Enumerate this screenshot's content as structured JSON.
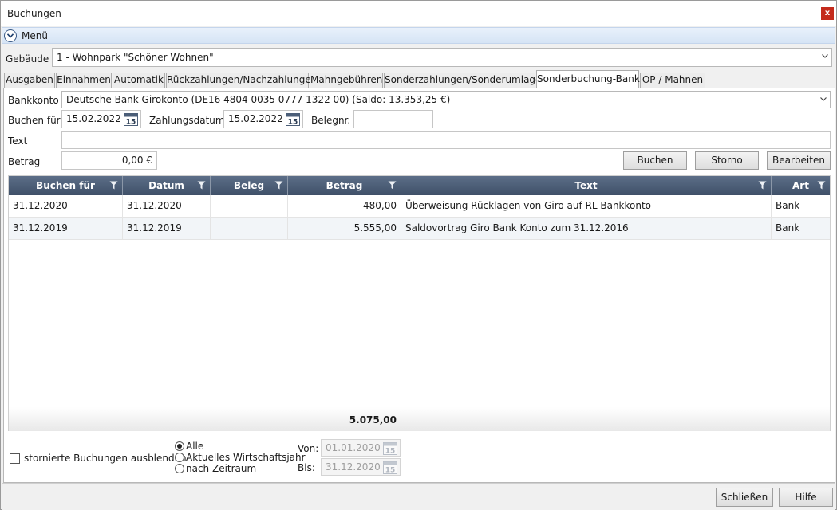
{
  "window": {
    "title": "Buchungen",
    "close_label": "x"
  },
  "menu": {
    "label": "Menü"
  },
  "building": {
    "label": "Gebäude",
    "value": "1 - Wohnpark \"Schöner Wohnen\""
  },
  "tabs": [
    {
      "label": "Ausgaben"
    },
    {
      "label": "Einnahmen"
    },
    {
      "label": "Automatik"
    },
    {
      "label": "Rückzahlungen/Nachzahlungen"
    },
    {
      "label": "Mahngebühren"
    },
    {
      "label": "Sonderzahlungen/Sonderumlagen"
    },
    {
      "label": "Sonderbuchung-Bank"
    },
    {
      "label": "OP / Mahnen"
    }
  ],
  "active_tab": "Sonderbuchung-Bank",
  "form": {
    "bankkonto_label": "Bankkonto",
    "bankkonto_value": "Deutsche Bank Girokonto (DE16 4804 0035 0777 1322 00) (Saldo: 13.353,25 €)",
    "buchen_fuer_label": "Buchen für",
    "buchen_fuer_value": "15.02.2022",
    "zahlungsdatum_label": "Zahlungsdatum",
    "zahlungsdatum_value": "15.02.2022",
    "belegnr_label": "Belegnr.",
    "belegnr_value": "",
    "text_label": "Text",
    "text_value": "",
    "betrag_label": "Betrag",
    "betrag_value": "0,00 €",
    "calendar_day": "15"
  },
  "buttons": {
    "buchen": "Buchen",
    "storno": "Storno",
    "bearbeiten": "Bearbeiten"
  },
  "grid": {
    "columns": [
      "Buchen für",
      "Datum",
      "Beleg",
      "Betrag",
      "Text",
      "Art"
    ],
    "rows": [
      {
        "buchen_fuer": "31.12.2020",
        "datum": "31.12.2020",
        "beleg": "",
        "betrag": "-480,00",
        "text": "Überweisung Rücklagen von Giro auf RL Bankkonto",
        "art": "Bank"
      },
      {
        "buchen_fuer": "31.12.2019",
        "datum": "31.12.2019",
        "beleg": "",
        "betrag": "5.555,00",
        "text": "Saldovortrag Giro Bank Konto zum 31.12.2016",
        "art": "Bank"
      }
    ],
    "total": "5.075,00"
  },
  "filter": {
    "hide_cancelled_label": "stornierte Buchungen ausblenden",
    "hide_cancelled_checked": false,
    "options": [
      "Alle",
      "Aktuelles Wirtschaftsjahr",
      "nach Zeitraum"
    ],
    "selected_option": "Alle",
    "von_label": "Von:",
    "von_value": "01.01.2020",
    "bis_label": "Bis:",
    "bis_value": "31.12.2020"
  },
  "footer": {
    "close_label": "Schließen",
    "help_label": "Hilfe"
  }
}
